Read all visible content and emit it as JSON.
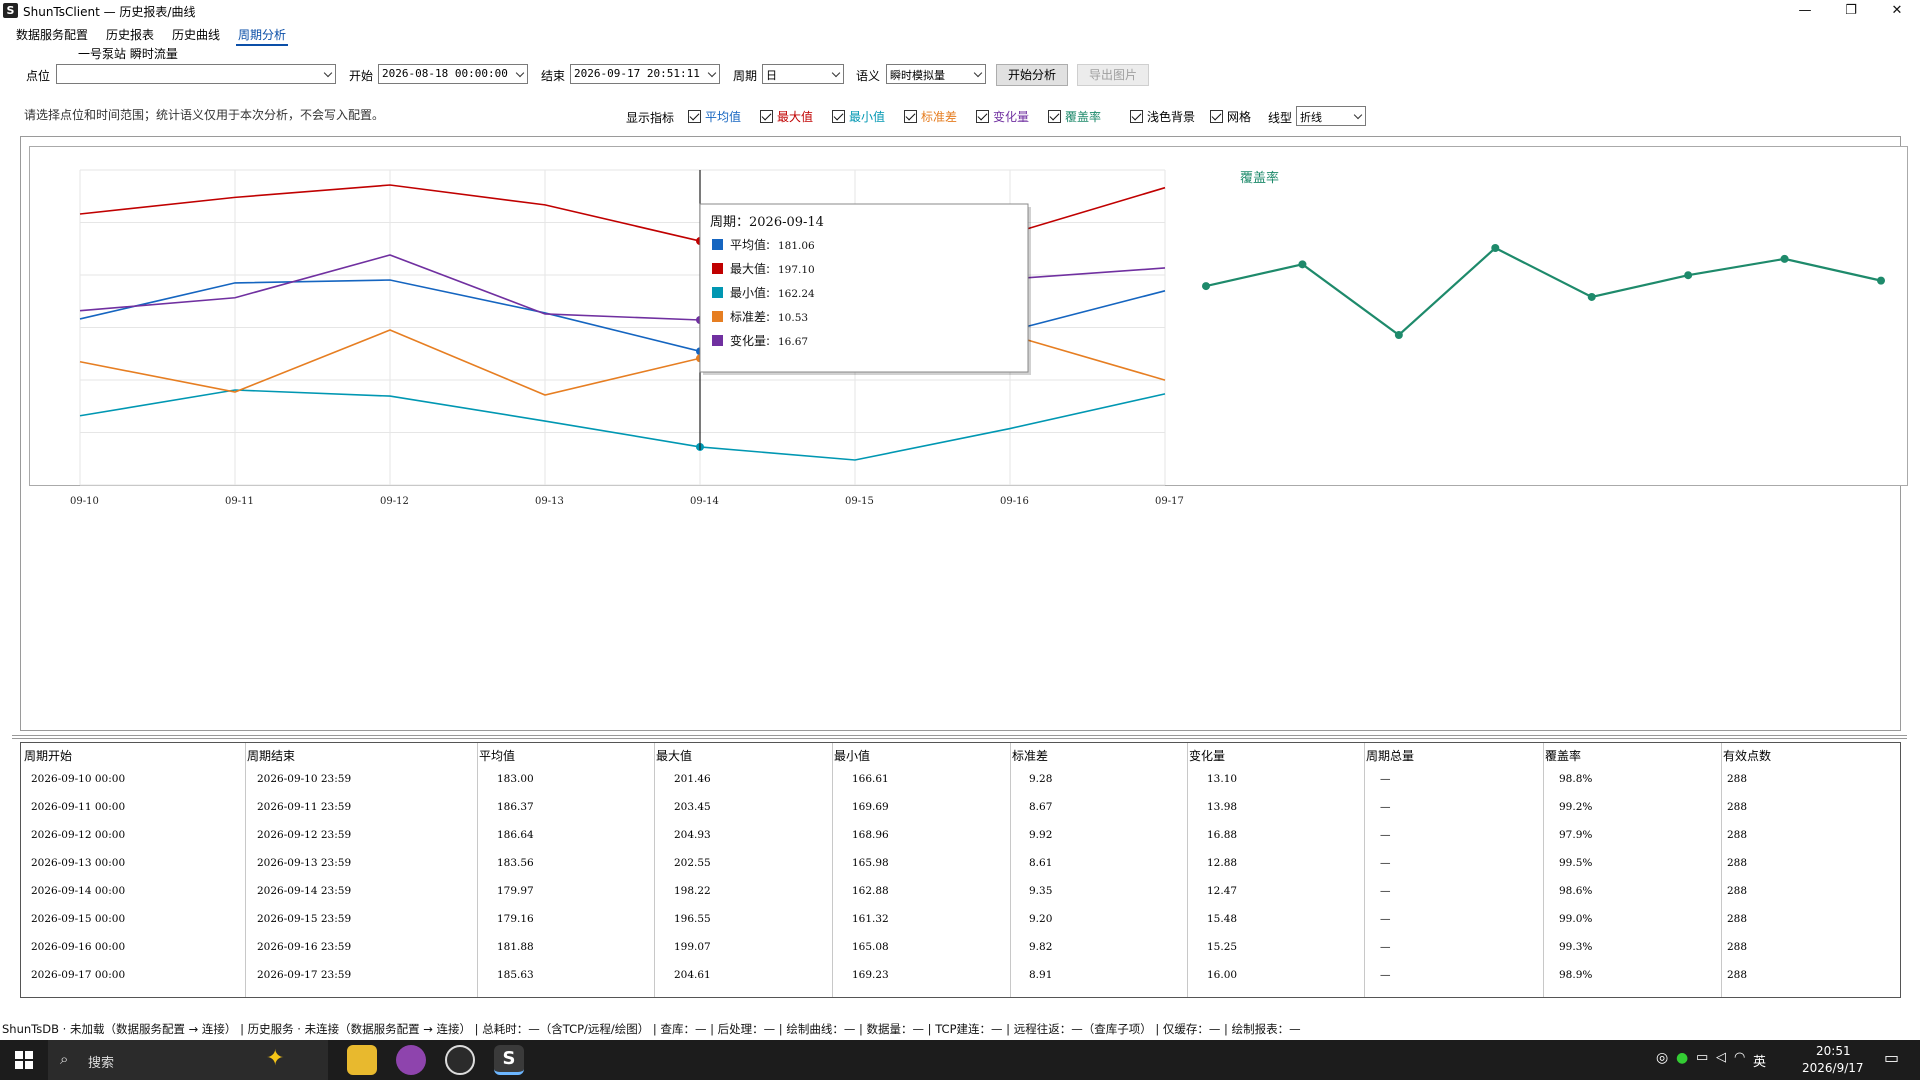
{
  "window": {
    "title": "ShunTsClient — 历史报表/曲线",
    "app_icon": "S",
    "controls": [
      "—",
      "❐",
      "✕"
    ]
  },
  "menu": [
    {
      "label": "数据服务配置",
      "active": false
    },
    {
      "label": "历史报表",
      "active": false
    },
    {
      "label": "历史曲线",
      "active": false
    },
    {
      "label": "周期分析",
      "active": true
    }
  ],
  "subtitle": "一号泵站 瞬时流量",
  "filters": {
    "point_label": "点位",
    "point_value": "",
    "start_label": "开始",
    "start_value": "2026-08-18 00:00:00",
    "end_label": "结束",
    "end_value": "2026-09-17 20:51:11",
    "period_label": "周期",
    "period_value": "日",
    "semantic_label": "语义",
    "semantic_value": "瞬时模拟量",
    "analyze_button": "开始分析",
    "export_button": "导出图片"
  },
  "hint": "请选择点位和时间范围；统计语义仅用于本次分析，不会写入配置。",
  "display": {
    "label": "显示指标",
    "metrics": [
      {
        "label": "平均值",
        "color": "#1565c0",
        "checked": true
      },
      {
        "label": "最大值",
        "color": "#c00000",
        "checked": true
      },
      {
        "label": "最小值",
        "color": "#0097b2",
        "checked": true
      },
      {
        "label": "标准差",
        "color": "#e67e22",
        "checked": true
      },
      {
        "label": "变化量",
        "color": "#7030a0",
        "checked": true
      },
      {
        "label": "覆盖率",
        "color": "#1e8a6b",
        "checked": true
      }
    ],
    "light_bg_label": "浅色背景",
    "grid_label": "网格",
    "linetype_label": "线型",
    "linetype_value": "折线"
  },
  "chart_data": [
    {
      "type": "line",
      "x": [
        "09-10",
        "09-11",
        "09-12",
        "09-13",
        "09-14",
        "09-15",
        "09-16",
        "09-17"
      ],
      "series": [
        {
          "name": "平均值",
          "color": "#1565c0",
          "values": [
            183.0,
            186.37,
            186.64,
            183.56,
            179.97,
            179.16,
            181.88,
            185.63
          ]
        },
        {
          "name": "最大值",
          "color": "#c00000",
          "values": [
            201.46,
            203.45,
            204.93,
            202.55,
            198.22,
            196.55,
            199.07,
            204.61
          ]
        },
        {
          "name": "最小值",
          "color": "#0097b2",
          "values": [
            166.61,
            169.69,
            168.96,
            165.98,
            162.88,
            161.32,
            165.08,
            169.23
          ]
        },
        {
          "name": "标准差",
          "color": "#e67e22",
          "values": [
            9.28,
            8.67,
            9.92,
            8.61,
            9.35,
            9.2,
            9.82,
            8.91
          ]
        },
        {
          "name": "变化量",
          "color": "#7030a0",
          "values": [
            13.1,
            13.98,
            16.88,
            12.88,
            12.47,
            15.48,
            15.25,
            16.0
          ]
        }
      ],
      "grid": true,
      "tooltip": {
        "title": "周期：2026-09-14",
        "rows": [
          {
            "label": "平均值",
            "value": "181.06",
            "color": "#1565c0"
          },
          {
            "label": "最大值",
            "value": "197.10",
            "color": "#c00000"
          },
          {
            "label": "最小值",
            "value": "162.24",
            "color": "#0097b2"
          },
          {
            "label": "标准差",
            "value": "10.53",
            "color": "#e67e22"
          },
          {
            "label": "变化量",
            "value": "16.67",
            "color": "#7030a0"
          }
        ]
      }
    },
    {
      "type": "line",
      "title": "覆盖率",
      "series": [
        {
          "name": "覆盖率",
          "color": "#1e8a6b",
          "values": [
            98.8,
            99.2,
            97.9,
            99.5,
            98.6,
            99.0,
            99.3,
            98.9
          ]
        }
      ]
    }
  ],
  "table": {
    "headers": [
      "周期开始",
      "周期结束",
      "平均值",
      "最大值",
      "最小值",
      "标准差",
      "变化量",
      "周期总量",
      "覆盖率",
      "有效点数"
    ],
    "rows": [
      [
        "2026-09-10 00:00",
        "2026-09-10 23:59",
        "183.00",
        "201.46",
        "166.61",
        "9.28",
        "13.10",
        "—",
        "98.8%",
        "288"
      ],
      [
        "2026-09-11 00:00",
        "2026-09-11 23:59",
        "186.37",
        "203.45",
        "169.69",
        "8.67",
        "13.98",
        "—",
        "99.2%",
        "288"
      ],
      [
        "2026-09-12 00:00",
        "2026-09-12 23:59",
        "186.64",
        "204.93",
        "168.96",
        "9.92",
        "16.88",
        "—",
        "97.9%",
        "288"
      ],
      [
        "2026-09-13 00:00",
        "2026-09-13 23:59",
        "183.56",
        "202.55",
        "165.98",
        "8.61",
        "12.88",
        "—",
        "99.5%",
        "288"
      ],
      [
        "2026-09-14 00:00",
        "2026-09-14 23:59",
        "179.97",
        "198.22",
        "162.88",
        "9.35",
        "12.47",
        "—",
        "98.6%",
        "288"
      ],
      [
        "2026-09-15 00:00",
        "2026-09-15 23:59",
        "179.16",
        "196.55",
        "161.32",
        "9.20",
        "15.48",
        "—",
        "99.0%",
        "288"
      ],
      [
        "2026-09-16 00:00",
        "2026-09-16 23:59",
        "181.88",
        "199.07",
        "165.08",
        "9.82",
        "15.25",
        "—",
        "99.3%",
        "288"
      ],
      [
        "2026-09-17 00:00",
        "2026-09-17 23:59",
        "185.63",
        "204.61",
        "169.23",
        "8.91",
        "16.00",
        "—",
        "98.9%",
        "288"
      ]
    ]
  },
  "status": "ShunTsDB · 未加载（数据服务配置 → 连接） | 历史服务 · 未连接（数据服务配置 → 连接） | 总耗时：—（含TCP/远程/绘图） | 查库：— | 后处理：— | 绘制曲线：— | 数据量：— | TCP建连：— | 远程往返：—（查库子项） | 仅缓存：— | 绘制报表：—",
  "taskbar": {
    "search": "搜索",
    "ime": "英",
    "time": "20:51",
    "date": "2026/9/17"
  }
}
